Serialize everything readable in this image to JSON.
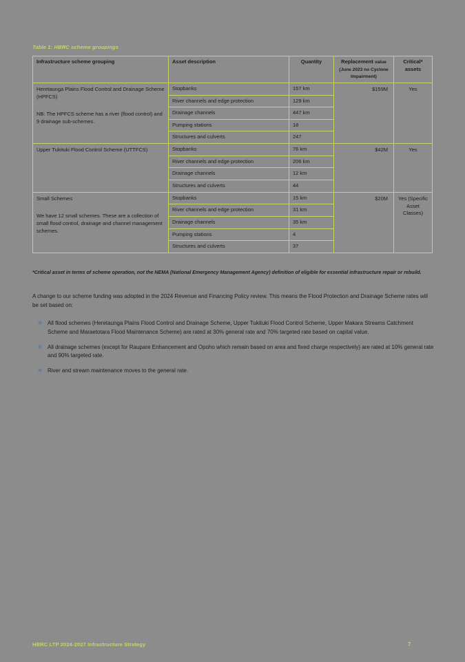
{
  "table": {
    "caption": "Table 1: HBRC scheme groupings",
    "columns": [
      {
        "label": "Infrastructure scheme grouping"
      },
      {
        "label": "Asset description"
      },
      {
        "label": "Quantity"
      },
      {
        "label": "Replacement",
        "sub": "value (June 2023 no Cyclone Impairment)"
      },
      {
        "label": "Critical* assets"
      }
    ],
    "groups": [
      {
        "title": "Heretaunga Plains Flood Control and Drainage Scheme (HPFCS)",
        "note": "NB: The HPFCS scheme has a river (flood control) and 9 drainage sub-schemes.",
        "replacement_value": "$159M",
        "critical": "Yes",
        "rows": [
          {
            "asset": "Stopbanks",
            "quantity": "157 km"
          },
          {
            "asset": "River channels and edge protection",
            "quantity": "129 km"
          },
          {
            "asset": "Drainage channels",
            "quantity": "447 km"
          },
          {
            "asset": "Pumping stations",
            "quantity": "18"
          },
          {
            "asset": "Structures and culverts",
            "quantity": "247"
          }
        ]
      },
      {
        "title": "Upper Tukituki Flood Control Scheme (UTTFCS)",
        "note": "",
        "replacement_value": "$42M",
        "critical": "Yes",
        "rows": [
          {
            "asset": "Stopbanks",
            "quantity": "76 km"
          },
          {
            "asset": "River channels and edge protection",
            "quantity": "206 km"
          },
          {
            "asset": "Drainage channels",
            "quantity": "12 km"
          },
          {
            "asset": "Structures and culverts",
            "quantity": "44"
          }
        ]
      },
      {
        "title": "Small Schemes",
        "note": "We have 12 small schemes. These are a collection of small flood control, drainage and channel management schemes.",
        "replacement_value": "$20M",
        "critical": "Yes (Specific Asset Classes)",
        "rows": [
          {
            "asset": "Stopbanks",
            "quantity": "15 km"
          },
          {
            "asset": "River channels and edge protection",
            "quantity": "31 km"
          },
          {
            "asset": "Drainage channels",
            "quantity": "35 km"
          },
          {
            "asset": "Pumping stations",
            "quantity": "4"
          },
          {
            "asset": "Structures and culverts",
            "quantity": "37"
          }
        ]
      }
    ]
  },
  "footnote": "*Critical asset in terms of scheme operation, not the NEMA (National Emergency Management Agency) definition of eligible for essential infrastructure repair or rebuild.",
  "body_paragraph": "A change to our scheme funding was adopted in the 2024 Revenue and Financing Policy review. This means the Flood Protection and Drainage Scheme rates will be set based on:",
  "bullets": [
    "All flood schemes (Heretaunga Plains Flood Control and Drainage Scheme, Upper Tukituki Flood Control Scheme, Upper Makara Streams Catchment Scheme and Maraetotara Flood Maintenance Scheme) are rated at 30% general rate and 70% targeted rate based on capital value.",
    "All drainage schemes (except for Raupare Enhancement and Opoho which remain based on area and fixed charge respectively) are rated at 10% general rate and 90% targeted rate.",
    "River and stream maintenance moves to the general rate."
  ],
  "bullet_marker": "✱",
  "footer": {
    "title": "HBRC LTP 2024-2027 Infrastructure Strategy",
    "page_number": "7"
  },
  "colors": {
    "header_background": "#0d4354",
    "border": "#c9d36a",
    "accent_text": "#c9d36a",
    "page_background": "#8c8c8c"
  }
}
